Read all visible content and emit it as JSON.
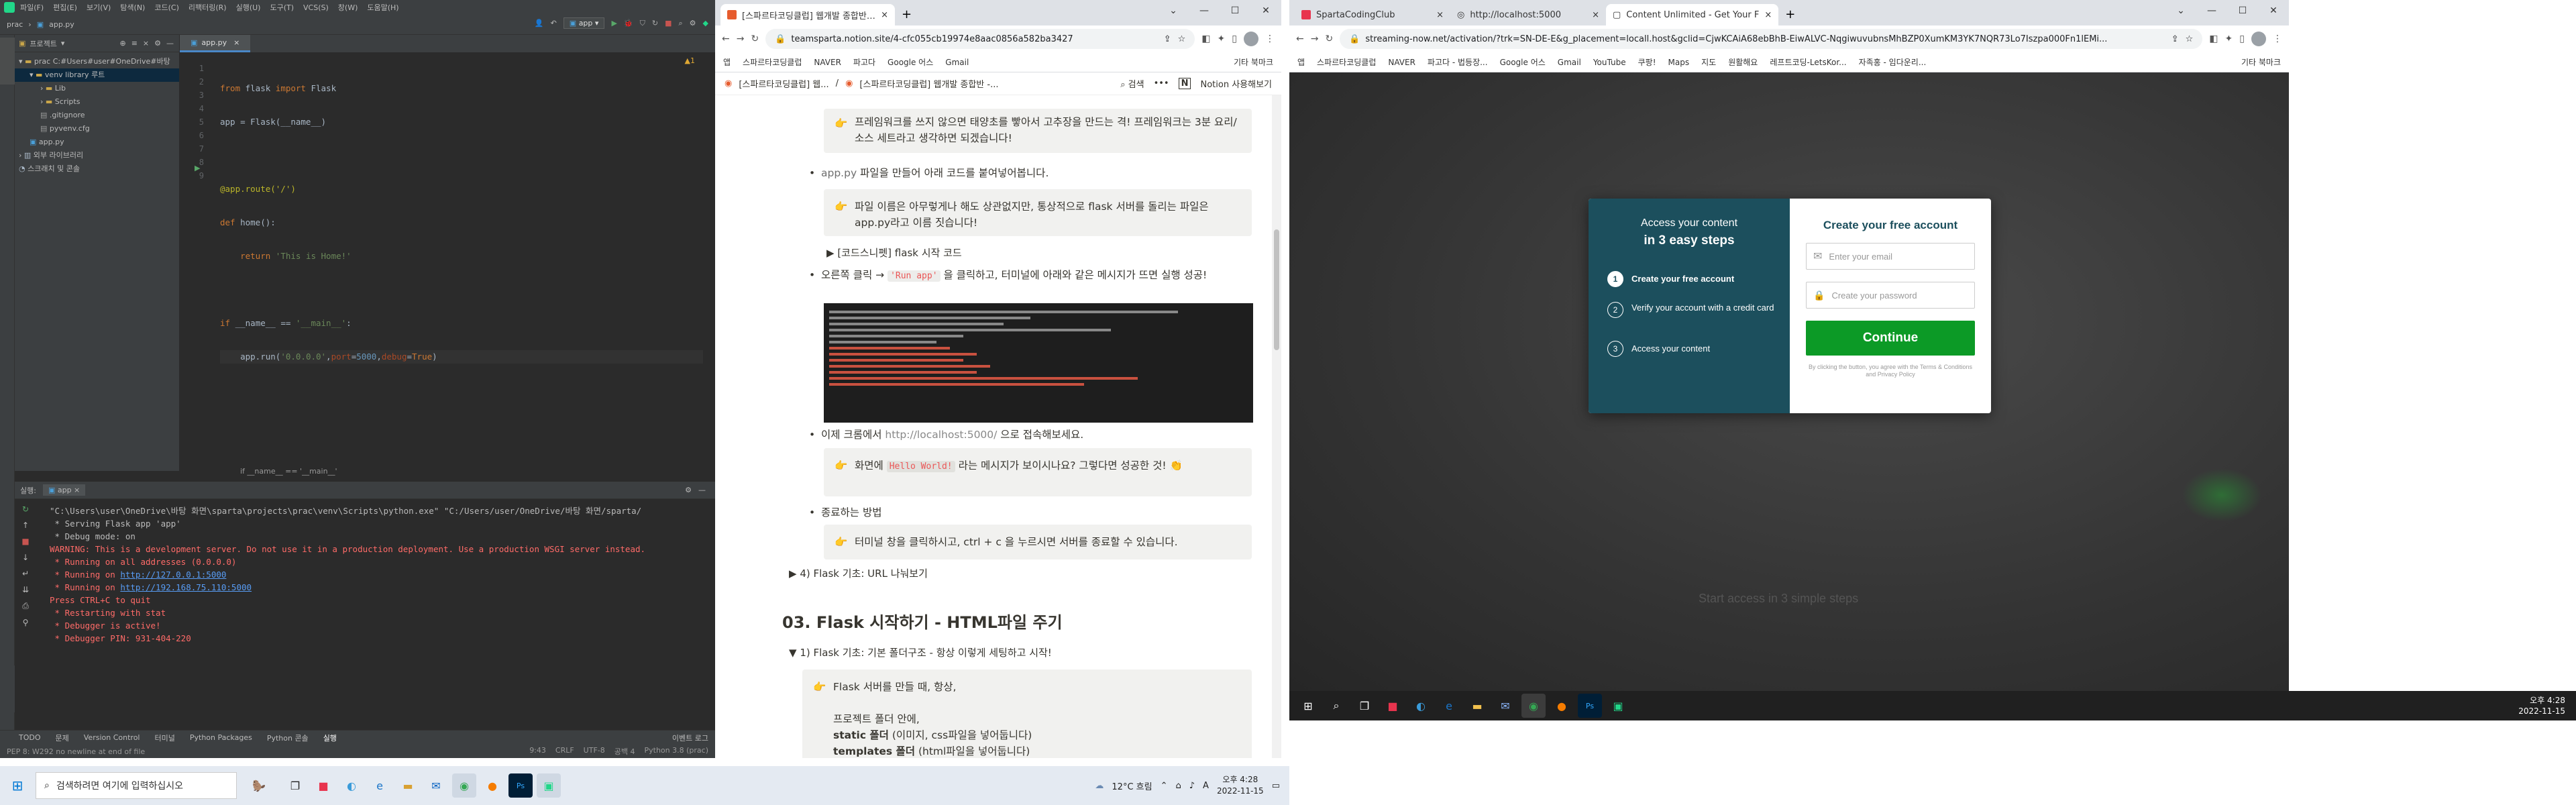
{
  "ide": {
    "menu": [
      "파일(F)",
      "편집(E)",
      "보기(V)",
      "탐색(N)",
      "코드(C)",
      "리팩터링(R)",
      "실행(U)",
      "도구(T)",
      "VCS(S)",
      "창(W)",
      "도움말(H)"
    ],
    "breadcrumb": [
      "prac",
      "app.py"
    ],
    "run_config": "app",
    "project_header": "프로젝트",
    "tree": [
      {
        "label": "prac  C:#Users#user#OneDrive#바탕",
        "depth": 0,
        "type": "folder",
        "open": true
      },
      {
        "label": "venv  library 루트",
        "depth": 1,
        "type": "folder",
        "open": true,
        "selected": true
      },
      {
        "label": "Lib",
        "depth": 2,
        "type": "folder",
        "open": false
      },
      {
        "label": "Scripts",
        "depth": 2,
        "type": "folder",
        "open": false
      },
      {
        "label": ".gitignore",
        "depth": 2,
        "type": "file"
      },
      {
        "label": "pyvenv.cfg",
        "depth": 2,
        "type": "file"
      },
      {
        "label": "app.py",
        "depth": 1,
        "type": "pyfile"
      },
      {
        "label": "외부 라이브러리",
        "depth": 0,
        "type": "lib"
      },
      {
        "label": "스크래치 및 콘솔",
        "depth": 0,
        "type": "scratch"
      }
    ],
    "editor_tab": "app.py",
    "warning_count": "1",
    "line_numbers": [
      "1",
      "2",
      "3",
      "4",
      "5",
      "6",
      "7",
      "8",
      "9"
    ],
    "code": {
      "l1_kw1": "from",
      "l1_mod": " flask ",
      "l1_kw2": "import",
      "l1_name": " Flask",
      "l2": "app = Flask(__name__)",
      "l4_dec": "@app.route('/')",
      "l5_kw": "def",
      "l5_rest": " home():",
      "l6_kw": "    return",
      "l6_str": " 'This is Home!'",
      "l8_kw": "if",
      "l8_mid": " __name__ == ",
      "l8_str": "'__main__'",
      "l8_end": ":",
      "l9_a": "    app.run(",
      "l9_s1": "'0.0.0.0'",
      "l9_b": ",",
      "l9_p1": "port",
      "l9_c": "=",
      "l9_n1": "5000",
      "l9_d": ",",
      "l9_p2": "debug",
      "l9_e": "=",
      "l9_t": "True",
      "l9_f": ")"
    },
    "editor_breadcrumb": "if __name__ == '__main__'",
    "run_header": "실행:",
    "run_tab": "app",
    "console": [
      {
        "text": "\"C:\\Users\\user\\OneDrive\\바탕 화면\\sparta\\projects\\prac\\venv\\Scripts\\python.exe\" \"C:/Users/user/OneDrive/바탕 화면/sparta/",
        "color": "#bbbbbb"
      },
      {
        "text": " * Serving Flask app 'app'",
        "color": "#bbbbbb"
      },
      {
        "text": " * Debug mode: on",
        "color": "#bbbbbb"
      },
      {
        "text": "WARNING: This is a development server. Do not use it in a production deployment. Use a production WSGI server instead.",
        "color": "#ff6b68"
      },
      {
        "text": " * Running on all addresses (0.0.0.0)",
        "color": "#ff6b68"
      },
      {
        "text": " * Running on http://127.0.0.1:5000",
        "color": "#ff6b68",
        "link": "http://127.0.0.1:5000"
      },
      {
        "text": " * Running on http://192.168.75.110:5000",
        "color": "#ff6b68",
        "link": "http://192.168.75.110:5000"
      },
      {
        "text": "Press CTRL+C to quit",
        "color": "#ff6b68"
      },
      {
        "text": " * Restarting with stat",
        "color": "#ff6b68"
      },
      {
        "text": " * Debugger is active!",
        "color": "#ff6b68"
      },
      {
        "text": " * Debugger PIN: 931-404-220",
        "color": "#ff6b68"
      }
    ],
    "bottom_tools": [
      "TODO",
      "문제",
      "Version Control",
      "터미널",
      "Python Packages",
      "Python 콘솔",
      "실행"
    ],
    "event_log": "이벤트 로그",
    "status_left": "PEP 8: W292 no newline at end of file",
    "status_right": [
      "9:43",
      "CRLF",
      "UTF-8",
      "공백 4",
      "Python 3.8 (prac)"
    ]
  },
  "notion_window": {
    "tabs": [
      {
        "title": "[스파르타코딩클럽] 웹개발 종합반 - 3주차",
        "active": true
      }
    ],
    "url": "teamsparta.notion.site/4-cfc055cb19974e8aac0856a582ba3427",
    "bookmarks": [
      "앱",
      "스파르타코딩클럽",
      "NAVER",
      "파고다",
      "Google 어스",
      "Gmail"
    ],
    "bookmarks_other": "기타 북마크",
    "header_items": [
      "[스파르타코딩클럽] 웹...",
      "[스파르타코딩클럽] 웹개발 종합반 -..."
    ],
    "header_right": [
      "검색",
      "Notion 사용해보기"
    ],
    "content": {
      "callout1": "프레임워크를 쓰지 않으면 태양초를 빻아서 고추장을 만드는 격! 프레임워크는 3분 요리/소스 세트라고 생각하면 되겠습니다!",
      "bullet1_a": "app.py",
      "bullet1_b": " 파일을 만들어 아래 코드를 붙여넣어봅니다.",
      "callout2": "파일 이름은 아무렇게나 해도 상관없지만, 통상적으로 flask 서버를 돌리는 파일은 app.py라고 이름 짓습니다!",
      "toggle1": "[코드스니펫] flask 시작 코드",
      "bullet2_a": "오른쪽 클릭 → ",
      "bullet2_code": "'Run app'",
      "bullet2_b": " 을 클릭하고, 터미널에 아래와 같은 메시지가 뜨면 실행 성공!",
      "bullet3_a": "이제 크롬에서 ",
      "bullet3_link": "http://localhost:5000/",
      "bullet3_b": " 으로 접속해보세요.",
      "callout3_a": "화면에 ",
      "callout3_code": "Hello World!",
      "callout3_b": " 라는 메시지가 보이시나요? 그렇다면 성공한 것!",
      "bullet4": "종료하는 방법",
      "callout4": "터미널 창을 클릭하시고, ctrl + c 을 누르시면 서버를 종료할 수 있습니다.",
      "toggle2": "4) Flask 기초: URL 나눠보기",
      "heading": "03. Flask 시작하기 - HTML파일 주기",
      "toggle3": "1) Flask 기초: 기본 폴더구조 - 항상 이렇게 세팅하고 시작!",
      "callout5_l1": "Flask 서버를 만들 때, 항상,",
      "callout5_l2": "프로젝트 폴더 안에,",
      "callout5_l3_b": "static 폴더",
      "callout5_l3": " (이미지, css파일을 넣어둡니다)",
      "callout5_l4_b": "templates 폴더",
      "callout5_l4": " (html파일을 넣어둡니다)"
    }
  },
  "stream_window": {
    "tabs": [
      {
        "title": "SpartaCodingClub",
        "active": false
      },
      {
        "title": "http://localhost:5000",
        "active": false
      },
      {
        "title": "Content Unlimited - Get Your F",
        "active": true
      }
    ],
    "url": "streaming-now.net/activation/?trk=SN-DE-E&g_placement=locall.host&gclid=CjwKCAiA68ebBhB-EiwALVC-NqgiwuvubnsMhBZP0XumKM3YK7NQR73Lo7Iszpa000Fn1lEMi...",
    "bookmarks": [
      "앱",
      "스파르타코딩클럽",
      "NAVER",
      "파고다 - 법등장...",
      "Google 어스",
      "Gmail",
      "YouTube",
      "쿠팡!",
      "Maps",
      "지도",
      "원활해요",
      "레프트코딩-LetsKor...",
      "자족홍 - 임다운리..."
    ],
    "bookmarks_other": "기타 북마크",
    "modal": {
      "left_title_1": "Access your content",
      "left_title_2": "in 3 easy steps",
      "steps": [
        {
          "n": "1",
          "text": "Create your free account",
          "bold": true
        },
        {
          "n": "2",
          "text": "Verify your account with a credit card",
          "bold": false
        },
        {
          "n": "3",
          "text": "Access your content",
          "bold": false
        }
      ],
      "right_title": "Create your free account",
      "email_placeholder": "Enter your email",
      "password_placeholder": "Create your password",
      "continue": "Continue",
      "terms": "By clicking the button, you agree with the Terms & Conditions and Privacy Policy"
    },
    "background_text": "Start access in 3 simple steps"
  },
  "taskbar_left": {
    "search_placeholder": "검색하려면 여기에 입력하십시오",
    "weather": "12°C 흐림",
    "time": "오후 4:28",
    "date": "2022-11-15"
  },
  "taskbar_right": {
    "time": "오후 4:28",
    "date": "2022-11-15"
  }
}
